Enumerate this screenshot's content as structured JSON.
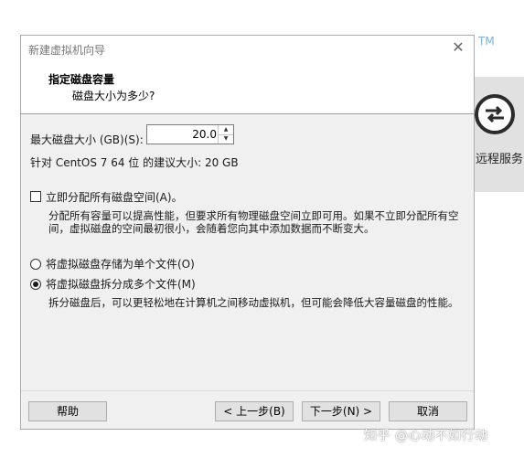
{
  "background": {
    "tm_text": "TM",
    "remote_service_label": "远程服务",
    "remote_icon": "remote-service-icon",
    "watermark": "知乎 @心动不如行动"
  },
  "dialog": {
    "title": "新建虚拟机向导",
    "close_glyph": "✕",
    "header_title": "指定磁盘容量",
    "header_subtitle": "磁盘大小为多少?",
    "max_size_label": "最大磁盘大小 (GB)(S):",
    "max_size_value": "20.0",
    "recommended": "针对 CentOS 7 64 位 的建议大小: 20 GB",
    "allocate_label": "立即分配所有磁盘空间(A)。",
    "allocate_checked": false,
    "allocate_desc": "分配所有容量可以提高性能，但要求所有物理磁盘空间立即可用。如果不立即分配所有空间，虚拟磁盘的空间最初很小，会随着您向其中添加数据而不断变大。",
    "single_file_label": "将虚拟磁盘存储为单个文件(O)",
    "multi_file_label": "将虚拟磁盘拆分成多个文件(M)",
    "selected_option": "multi",
    "multi_desc": "拆分磁盘后，可以更轻松地在计算机之间移动虚拟机，但可能会降低大容量磁盘的性能。",
    "buttons": {
      "help": "帮助",
      "back": "< 上一步(B)",
      "next": "下一步(N) >",
      "cancel": "取消"
    }
  }
}
